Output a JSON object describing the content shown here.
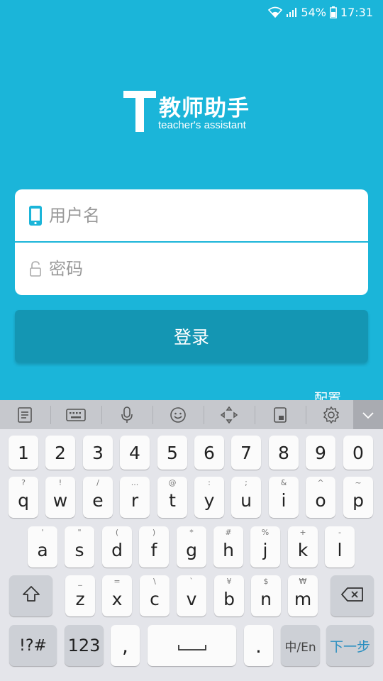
{
  "status_bar": {
    "battery": "54%",
    "time": "17:31"
  },
  "logo": {
    "letter": "T",
    "title": "教师助手",
    "subtitle": "teacher's assistant"
  },
  "login": {
    "username_placeholder": "用户名",
    "password_placeholder": "密码",
    "button_label": "登录",
    "config_label": "配置"
  },
  "colors": {
    "brand": "#1bb5d9",
    "button": "#1496b3",
    "keyboard_bg": "#e4e5ea"
  },
  "keyboard": {
    "toolbar": [
      "clipboard-icon",
      "keyboard-layout-icon",
      "microphone-icon",
      "emoji-icon",
      "cursor-move-icon",
      "one-handed-icon",
      "settings-icon",
      "chevron-down-icon"
    ],
    "row_numbers": [
      "1",
      "2",
      "3",
      "4",
      "5",
      "6",
      "7",
      "8",
      "9",
      "0"
    ],
    "row_q": [
      {
        "k": "q",
        "h": "?"
      },
      {
        "k": "w",
        "h": "!"
      },
      {
        "k": "e",
        "h": "/"
      },
      {
        "k": "r",
        "h": "..."
      },
      {
        "k": "t",
        "h": "@"
      },
      {
        "k": "y",
        "h": ":"
      },
      {
        "k": "u",
        "h": ";"
      },
      {
        "k": "i",
        "h": "&"
      },
      {
        "k": "o",
        "h": "^"
      },
      {
        "k": "p",
        "h": "~"
      }
    ],
    "row_a": [
      {
        "k": "a",
        "h": "'"
      },
      {
        "k": "s",
        "h": "\""
      },
      {
        "k": "d",
        "h": "("
      },
      {
        "k": "f",
        "h": ")"
      },
      {
        "k": "g",
        "h": "*"
      },
      {
        "k": "h",
        "h": "#"
      },
      {
        "k": "j",
        "h": "%"
      },
      {
        "k": "k",
        "h": "+"
      },
      {
        "k": "l",
        "h": "-"
      }
    ],
    "row_z": [
      {
        "k": "z",
        "h": "_"
      },
      {
        "k": "x",
        "h": "="
      },
      {
        "k": "c",
        "h": "\\"
      },
      {
        "k": "v",
        "h": "`"
      },
      {
        "k": "b",
        "h": "¥"
      },
      {
        "k": "n",
        "h": "$"
      },
      {
        "k": "m",
        "h": "₩"
      }
    ],
    "symbols_key": "!?#",
    "numbers_key": "123",
    "comma_key": ",",
    "period_key": ".",
    "lang_key": "中/En",
    "next_key": "下一步"
  }
}
